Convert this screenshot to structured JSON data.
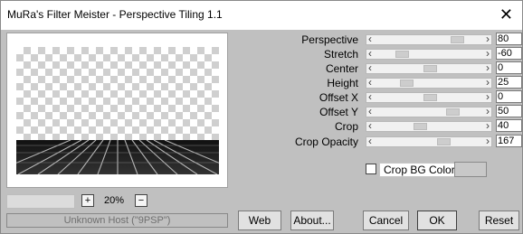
{
  "window": {
    "title": "MuRa's Filter Meister - Perspective Tiling 1.1"
  },
  "controls": [
    {
      "label": "Perspective",
      "value": "80",
      "level": 0.8
    },
    {
      "label": "Stretch",
      "value": "-60",
      "level": 0.2
    },
    {
      "label": "Center",
      "value": "0",
      "level": 0.5
    },
    {
      "label": "Height",
      "value": "25",
      "level": 0.25
    },
    {
      "label": "Offset X",
      "value": "0",
      "level": 0.5
    },
    {
      "label": "Offset Y",
      "value": "50",
      "level": 0.75
    },
    {
      "label": "Crop",
      "value": "40",
      "level": 0.4
    },
    {
      "label": "Crop Opacity",
      "value": "167",
      "level": 0.65
    }
  ],
  "crop_bg": {
    "label": "Crop BG Color",
    "checked": false,
    "color": "#c8c8c8"
  },
  "zoom": {
    "plus": "+",
    "minus": "−",
    "value": "20%"
  },
  "status": "Unknown Host (\"9PSP\")",
  "buttons": {
    "web": "Web",
    "about": "About...",
    "cancel": "Cancel",
    "ok": "OK",
    "reset": "Reset"
  }
}
